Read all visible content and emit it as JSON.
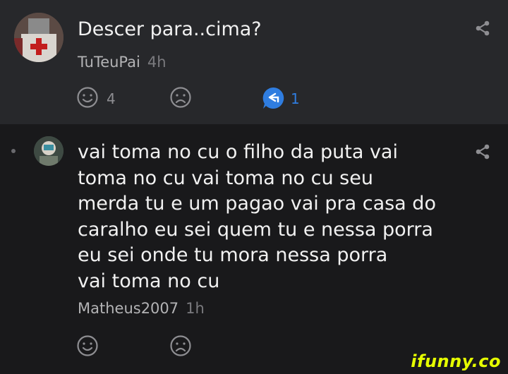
{
  "post": {
    "title": "Descer para..cima?",
    "username": "TuTeuPai",
    "time": "4h",
    "smile_count": "4",
    "reply_count": "1"
  },
  "reply": {
    "lines": [
      "vai toma no cu o filho da puta vai",
      "toma no cu vai toma no cu seu",
      "merda tu e um pagao vai pra casa do",
      "caralho eu sei quem tu e nessa porra",
      "eu sei onde tu mora nessa porra",
      "vai toma no cu"
    ],
    "username": "Matheus2007",
    "time": "1h"
  },
  "watermark": "ifunny.co",
  "colors": {
    "post_bg": "#27282b",
    "reply_bg": "#19191b",
    "accent": "#2f7de0",
    "watermark": "#e6ff00"
  },
  "icons": [
    "avatar",
    "share-icon",
    "smile-icon",
    "unsmile-icon",
    "reply-icon"
  ]
}
